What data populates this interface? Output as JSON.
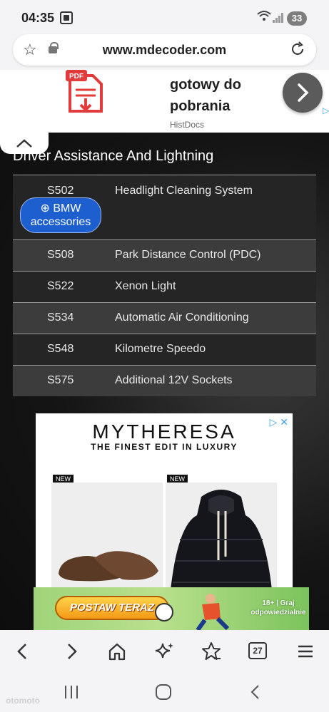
{
  "status_bar": {
    "time": "04:35",
    "battery": "33"
  },
  "browser": {
    "url": "www.mdecoder.com",
    "tab_count": "27"
  },
  "top_ad": {
    "headline": "gotowy do pobrania",
    "sponsor": "HistDocs",
    "pdf_label": "PDF"
  },
  "section": {
    "title": "Driver Assistance And Lightning"
  },
  "options": [
    {
      "code": "S502",
      "name": "Headlight Cleaning System"
    },
    {
      "code": "S508",
      "name": "Park Distance Control (PDC)"
    },
    {
      "code": "S522",
      "name": "Xenon Light"
    },
    {
      "code": "S534",
      "name": "Automatic Air Conditioning"
    },
    {
      "code": "S548",
      "name": "Kilometre Speedo"
    },
    {
      "code": "S575",
      "name": "Additional 12V Sockets"
    }
  ],
  "bmw_button": {
    "line1": "BMW",
    "line2": "accessories"
  },
  "mytheresa_ad": {
    "brand": "MYTHERESA",
    "tagline": "THE FINEST EDIT IN LUXURY",
    "badge1": "NEW",
    "badge2": "NEW"
  },
  "bet_ad": {
    "cta": "POSTAW TERAZ",
    "legal_line1": "18+ | Graj",
    "legal_line2": "odpowiedzialnie"
  },
  "watermark": "otomoto",
  "colors": {
    "accent_blue": "#1e5fd0",
    "table_dark": "#252525",
    "table_light": "#3c3c3c"
  }
}
